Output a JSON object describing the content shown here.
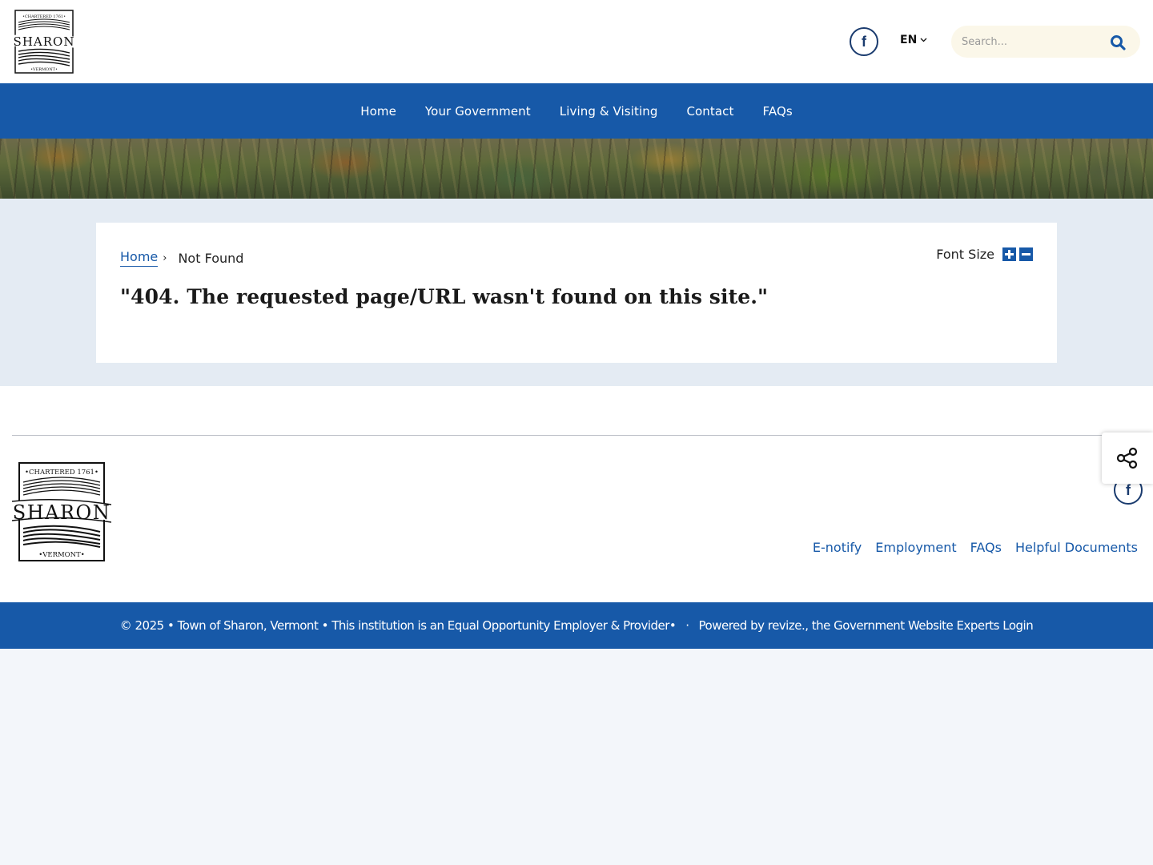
{
  "header": {
    "logo": {
      "top_text": "•CHARTERED 1761•",
      "name": "SHARON",
      "bottom_text": "•VERMONT•"
    },
    "facebook_label": "f",
    "language": "EN",
    "search": {
      "placeholder": "Search..."
    }
  },
  "nav": {
    "items": [
      {
        "label": "Home"
      },
      {
        "label": "Your Government"
      },
      {
        "label": "Living & Visiting"
      },
      {
        "label": "Contact"
      },
      {
        "label": "FAQs"
      }
    ]
  },
  "breadcrumb": {
    "home": "Home",
    "separator": "›",
    "current": "Not Found"
  },
  "font_size": {
    "label": "Font Size"
  },
  "main": {
    "title": "\"404. The requested page/URL wasn't found on this site.\""
  },
  "footer": {
    "logo": {
      "top_text": "•CHARTERED 1761•",
      "name": "SHARON",
      "bottom_text": "•VERMONT•"
    },
    "facebook_label": "f",
    "links": [
      {
        "label": "E-notify"
      },
      {
        "label": "Employment"
      },
      {
        "label": "FAQs"
      },
      {
        "label": "Helpful Documents"
      }
    ],
    "copyright": "© 2025 • Town of Sharon, Vermont • This institution is an Equal Opportunity Employer & Provider•",
    "separator": "·",
    "powered_by": "Powered by revize., the Government Website Experts",
    "login": "Login"
  },
  "colors": {
    "brand_blue": "#1759a8",
    "dark_navy": "#1a3b6e",
    "content_bg": "#e4ebf3"
  }
}
